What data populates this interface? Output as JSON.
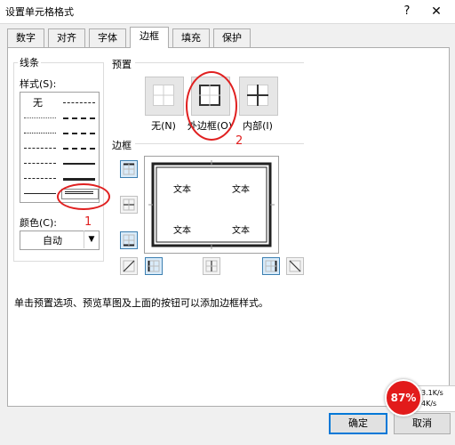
{
  "window": {
    "title": "设置单元格格式",
    "help": "?",
    "close": "✕"
  },
  "tabs": [
    {
      "label": "数字"
    },
    {
      "label": "对齐"
    },
    {
      "label": "字体"
    },
    {
      "label": "边框",
      "active": true
    },
    {
      "label": "填充"
    },
    {
      "label": "保护"
    }
  ],
  "line": {
    "group_label": "线条",
    "style_label": "样式(S):",
    "none_label": "无",
    "color_label": "颜色(C):",
    "color_value": "自动"
  },
  "preset": {
    "group_label": "预置",
    "items": [
      {
        "label": "无(N)",
        "icon": "preset-none-icon"
      },
      {
        "label": "外边框(O)",
        "icon": "preset-outline-icon"
      },
      {
        "label": "内部(I)",
        "icon": "preset-inside-icon"
      }
    ]
  },
  "border": {
    "group_label": "边框",
    "preview_texts": [
      "文本",
      "文本",
      "文本",
      "文本"
    ]
  },
  "hint": "单击预置选项、预览草图及上面的按钮可以添加边框样式。",
  "buttons": {
    "ok": "确定",
    "cancel": "取消"
  },
  "annotations": {
    "one": "1",
    "two": "2",
    "color": "#e02020"
  },
  "net_widget": {
    "percent": "87%",
    "up": "3.1K/s",
    "down": "4K/s"
  }
}
